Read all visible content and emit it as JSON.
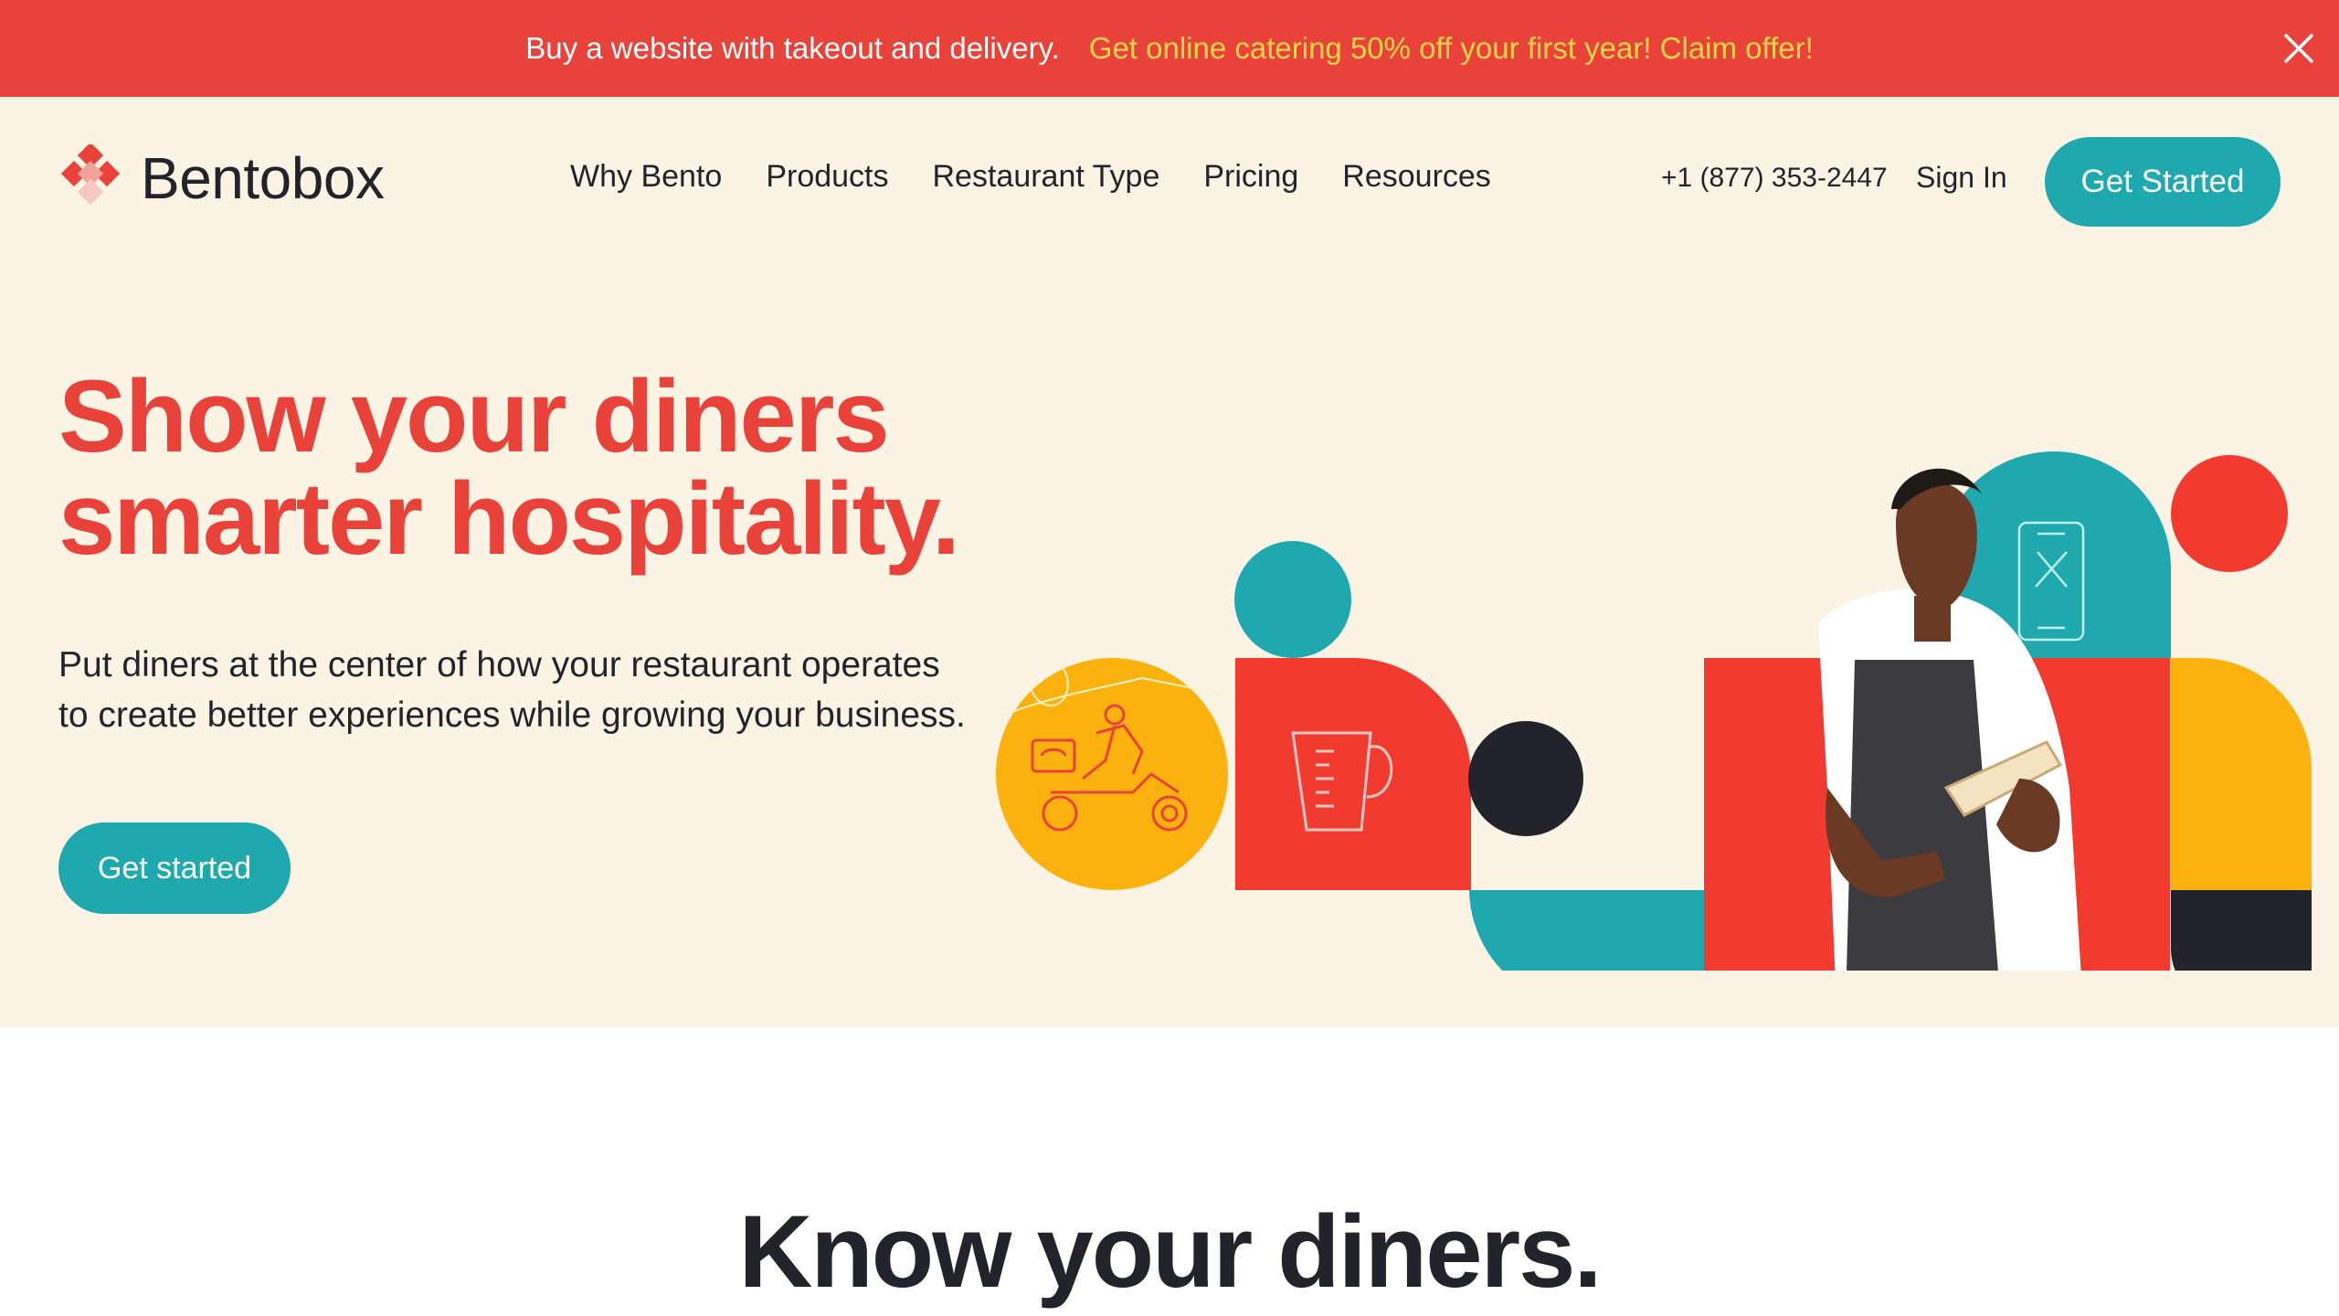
{
  "promo": {
    "text": "Buy a website with takeout and delivery.",
    "link": "Get online catering 50% off your first year! Claim offer!",
    "close_icon": "close-icon"
  },
  "header": {
    "logo_text": "Bentobox",
    "nav": [
      "Why Bento",
      "Products",
      "Restaurant Type",
      "Pricing",
      "Resources"
    ],
    "phone": "+1 (877) 353-2447",
    "sign_in": "Sign In",
    "cta": "Get Started"
  },
  "hero": {
    "title_line1": "Show your diners",
    "title_line2": "smarter hospitality.",
    "subtitle": "Put diners at the center of how your restaurant operates to create better experiences while growing your business.",
    "cta": "Get started",
    "icons": [
      "delivery-scooter-icon",
      "measuring-cup-icon",
      "mobile-menu-icon"
    ]
  },
  "section2": {
    "title": "Know your diners."
  },
  "colors": {
    "brand_red": "#e8423a",
    "accent_teal": "#1fa8ae",
    "accent_yellow": "#fbb20f",
    "dark": "#23232b",
    "cream": "#fbf4e4",
    "promo_link": "#ffd54a"
  }
}
